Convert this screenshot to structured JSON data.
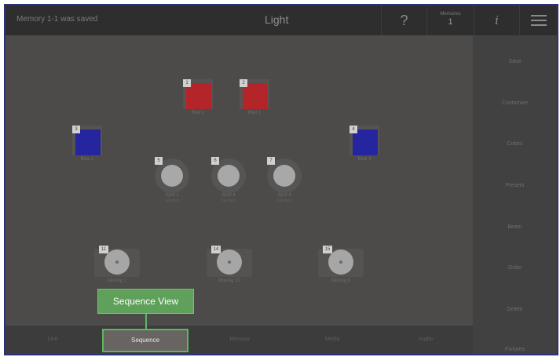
{
  "header": {
    "status": "Memory 1-1 was saved",
    "title": "Light",
    "help_label": "?",
    "memories_label": "Memories",
    "memory_value": "1",
    "info_label": "i"
  },
  "fixtures": {
    "red_1": {
      "num": "1",
      "label": "Red 1"
    },
    "red_2": {
      "num": "2",
      "label": "Red 1"
    },
    "blue_left": {
      "num": "3",
      "label": "Blue 1"
    },
    "blue_right": {
      "num": "4",
      "label": "Blue 4"
    },
    "spot_1": {
      "num": "5",
      "label": "Spot 1",
      "sub": "Spotlight"
    },
    "spot_2": {
      "num": "6",
      "label": "Spot 4",
      "sub": "Spotlight"
    },
    "spot_3": {
      "num": "7",
      "label": "Spot 4",
      "sub": "Spotlight"
    },
    "mover_1": {
      "num": "11",
      "label": "Moving 1"
    },
    "mover_2": {
      "num": "14",
      "label": "Moving 10"
    },
    "mover_3": {
      "num": "15",
      "label": "Moving 8"
    }
  },
  "sidebar": {
    "items": [
      "Save",
      "Customize",
      "Colors",
      "Presets",
      "Beam",
      "Gobo",
      "Delete",
      "Fixtures"
    ]
  },
  "bottombar": {
    "tabs": [
      "Live",
      "Sequence",
      "Memory",
      "Media",
      "Audio"
    ]
  },
  "tooltip": {
    "text": "Sequence View"
  },
  "colors": {
    "accent": "#5cb85c",
    "red_fixture": "#b32528",
    "blue_fixture": "#2525a0",
    "frame_border": "#2c3276"
  }
}
